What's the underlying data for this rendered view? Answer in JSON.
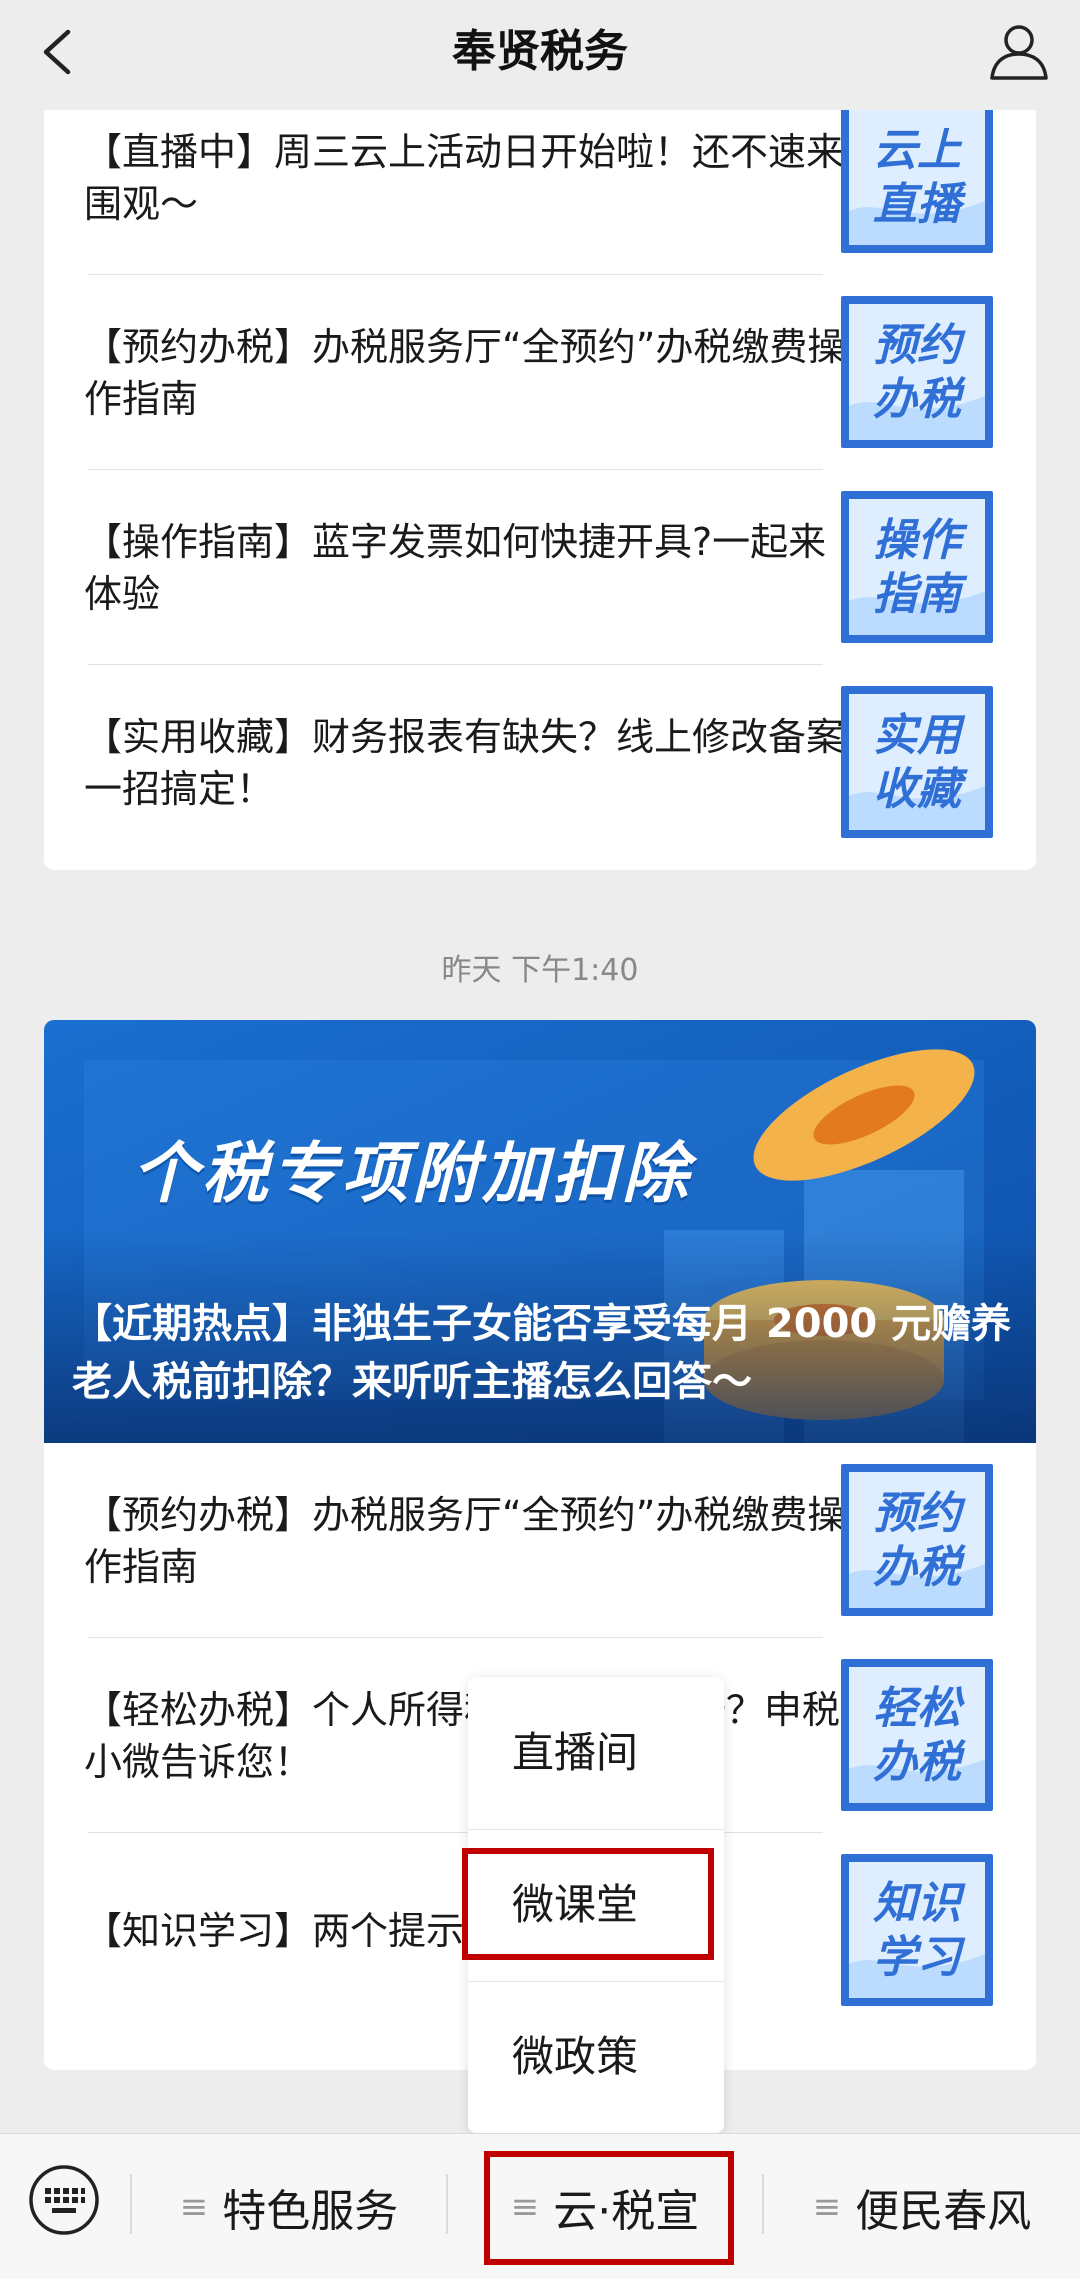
{
  "header": {
    "title": "奉贤税务"
  },
  "card1": {
    "items": [
      {
        "text": "【直播中】周三云上活动日开始啦！还不速来围观～",
        "thumb": "云上\n直播"
      },
      {
        "text": "【预约办税】办税服务厅“全预约”办税缴费操作指南",
        "thumb": "预约\n办税"
      },
      {
        "text": "【操作指南】蓝字发票如何快捷开具?一起来体验",
        "thumb": "操作\n指南"
      },
      {
        "text": "【实用收藏】财务报表有缺失？线上修改备案一招搞定！",
        "thumb": "实用\n收藏"
      }
    ]
  },
  "timestamp": "昨天 下午1:40",
  "card2": {
    "hero_big": "个税专项附加扣除",
    "hero_caption": "【近期热点】非独生子女能否享受每月 2000 元赡养老人税前扣除？来听听主播怎么回答～",
    "items": [
      {
        "text": "【预约办税】办税服务厅“全预约”办税缴费操作指南",
        "thumb": "预约\n办税"
      },
      {
        "text": "【轻松办税】个人所得税APP如何注册？申税小微告诉您！",
        "thumb": "轻松\n办税"
      },
      {
        "text": "【知识学习】两个提示教您如何开票",
        "thumb": "知识\n学习"
      }
    ]
  },
  "popup_menu": {
    "items": [
      "直播间",
      "微课堂",
      "微政策"
    ]
  },
  "bottom_menu": {
    "tabs": [
      "特色服务",
      "云·税宣",
      "便民春风"
    ]
  },
  "colors": {
    "highlight": "#c00000",
    "thumb_blue": "#2f6fd6",
    "hero_blue": "#1560c4"
  }
}
